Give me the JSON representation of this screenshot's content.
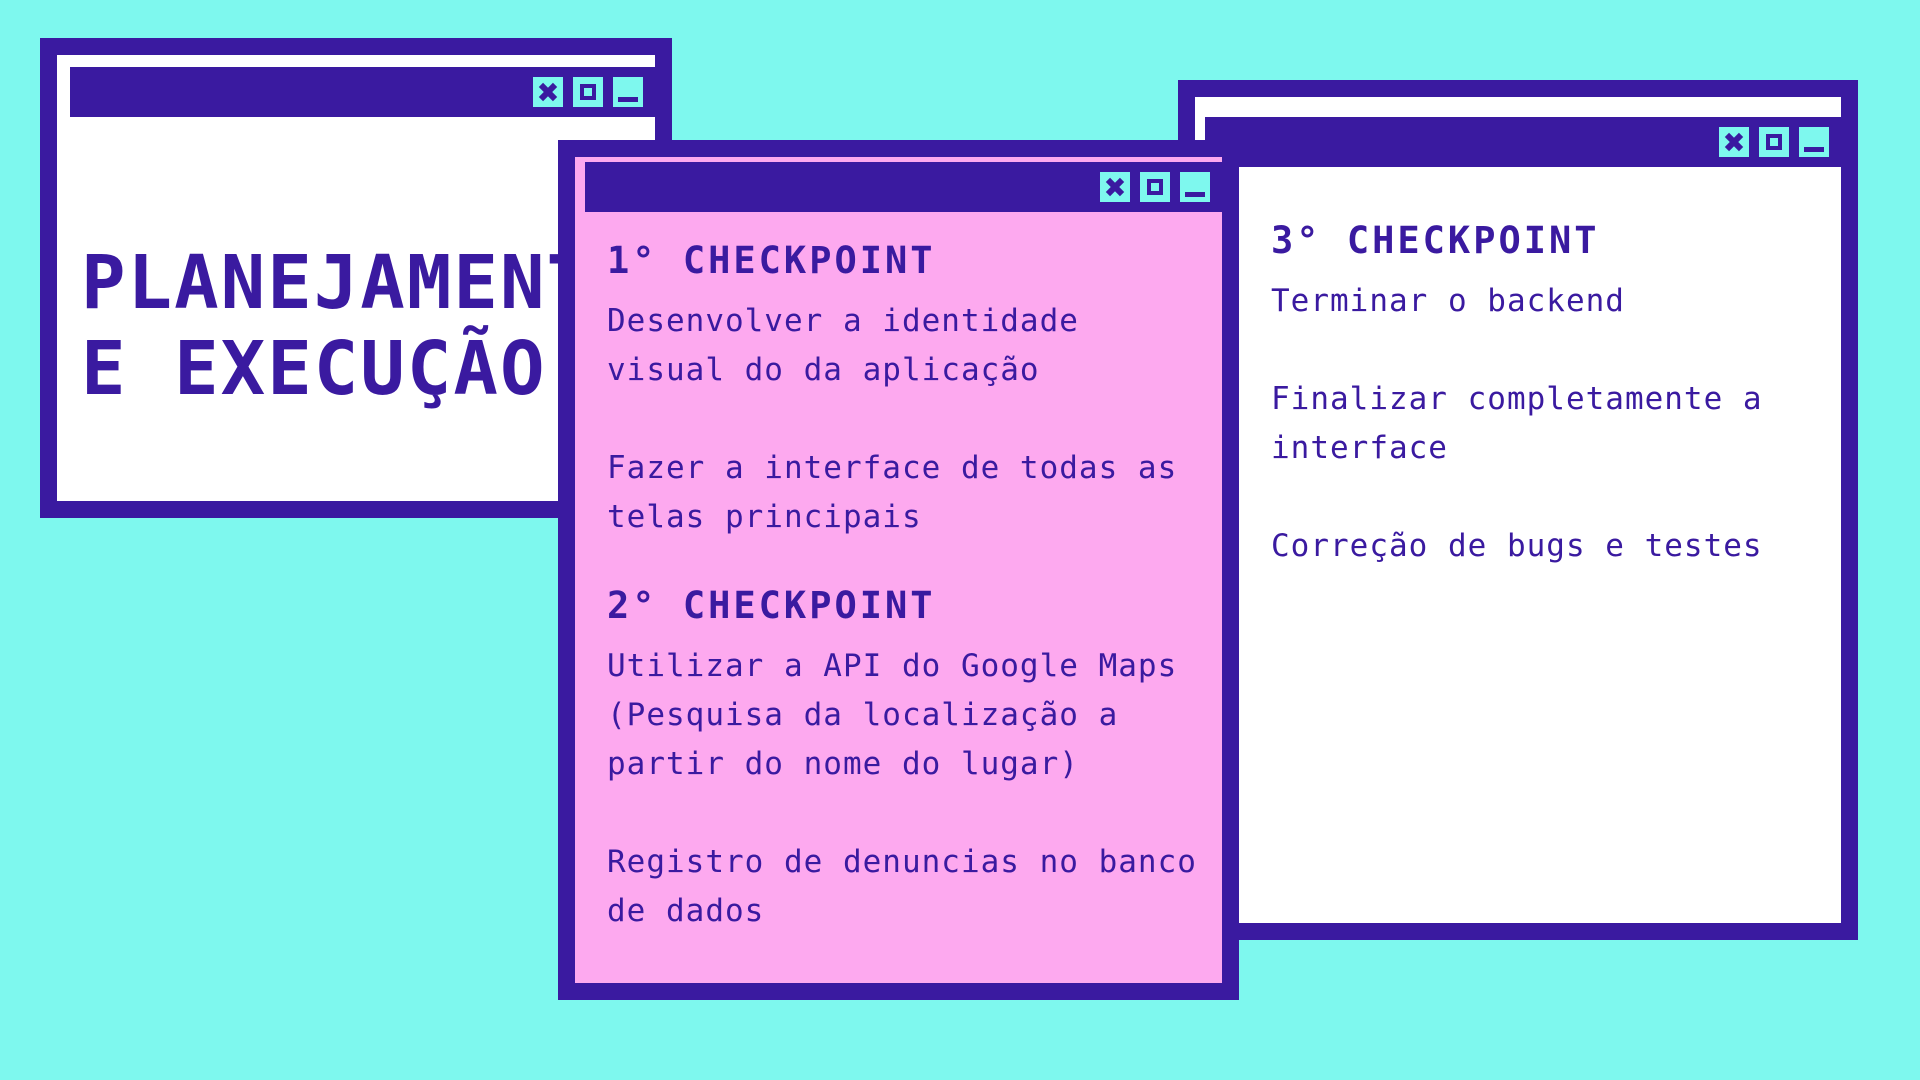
{
  "title_window": {
    "title_line1": "PLANEJAMENTO",
    "title_line2": "E EXECUÇÃO"
  },
  "checkpoints_window": {
    "sections": [
      {
        "heading": "1° CHECKPOINT",
        "items": [
          "Desenvolver a identidade visual do da aplicação",
          "Fazer a interface de todas as telas principais"
        ]
      },
      {
        "heading": "2° CHECKPOINT",
        "items": [
          "Utilizar a API do Google Maps (Pesquisa da localização a partir do nome do lugar)",
          "Registro de denuncias no banco de dados"
        ]
      }
    ]
  },
  "checkpoint3_window": {
    "heading": "3° CHECKPOINT",
    "items": [
      "Terminar o backend",
      "Finalizar completamente a interface",
      "Correção de bugs e testes"
    ]
  },
  "icons": [
    "close-icon",
    "maximize-icon",
    "minimize-icon"
  ],
  "colors": {
    "background": "#7ef8ee",
    "frame": "#3a1aa0",
    "pink_window": "#fda9ef",
    "white_window": "#ffffff"
  }
}
